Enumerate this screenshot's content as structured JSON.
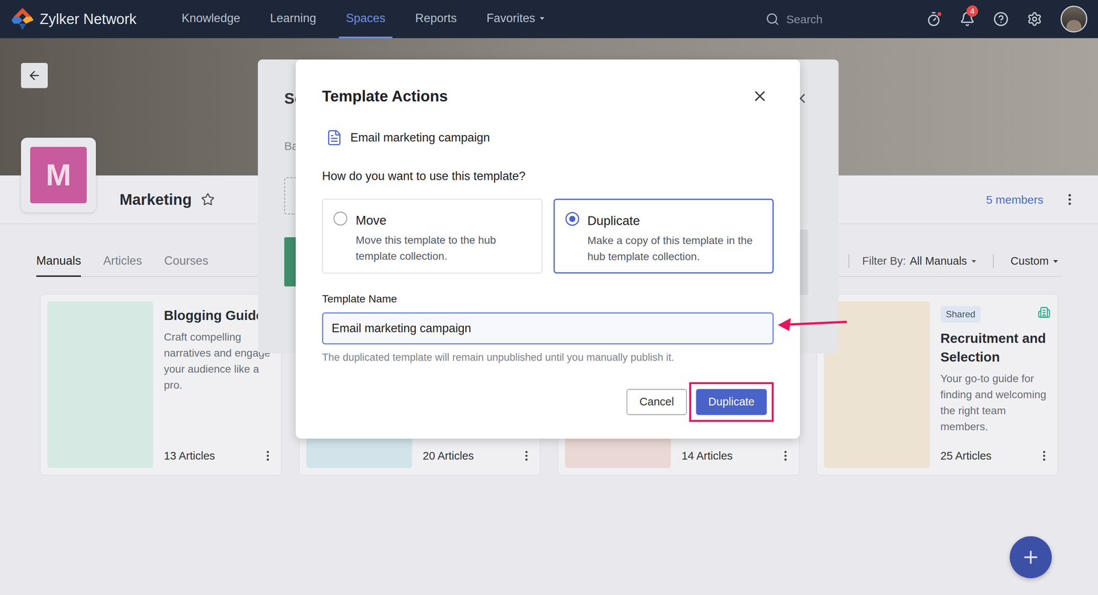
{
  "nav": {
    "brand": "Zylker Network",
    "items": [
      {
        "label": "Knowledge",
        "selected": false,
        "has_menu": false
      },
      {
        "label": "Learning",
        "selected": false,
        "has_menu": false
      },
      {
        "label": "Spaces",
        "selected": true,
        "has_menu": false
      },
      {
        "label": "Reports",
        "selected": false,
        "has_menu": false
      },
      {
        "label": "Favorites",
        "selected": false,
        "has_menu": true
      }
    ],
    "search": {
      "placeholder": "Search"
    },
    "notifications": {
      "count": "4"
    }
  },
  "space": {
    "initial": "M",
    "name": "Marketing",
    "favorite": false,
    "members": "5 members"
  },
  "tabs": [
    {
      "label": "Manuals",
      "selected": true
    },
    {
      "label": "Articles",
      "selected": false
    },
    {
      "label": "Courses",
      "selected": false
    }
  ],
  "filter": {
    "label": "Filter By:",
    "value": "All Manuals"
  },
  "sort": {
    "value": "Custom"
  },
  "cards": [
    {
      "title": "Blogging Guide",
      "description": "Craft compelling narratives and engage your audience like a pro.",
      "count": "13 Articles",
      "color": "#d7e9e3"
    },
    {
      "count": "20 Articles",
      "color": "#d2e4ea"
    },
    {
      "count": "14 Articles",
      "color": "#ead8d4"
    },
    {
      "title": "Recruitment and Selection",
      "description": "Your go-to guide for finding and welcoming the right team members.",
      "badge": "Shared",
      "count": "25 Articles",
      "color": "#ece3d3"
    }
  ],
  "background_dialog": {
    "title": "Se",
    "tab": "Ba"
  },
  "dialog": {
    "title": "Template Actions",
    "template_name": "Email marketing campaign",
    "question": "How do you want to use this template?",
    "options": [
      {
        "title": "Move",
        "description": "Move this template to the hub template collection.",
        "selected": false
      },
      {
        "title": "Duplicate",
        "description": "Make a copy of this template in the hub template collection.",
        "selected": true
      }
    ],
    "field": {
      "label": "Template Name",
      "value": "Email marketing campaign",
      "focused": true
    },
    "helper": "The duplicated template will remain unpublished until you manually publish it.",
    "buttons": [
      {
        "label": "Cancel",
        "kind": "secondary",
        "highlighted": false
      },
      {
        "label": "Duplicate",
        "kind": "primary",
        "highlighted": true
      }
    ]
  }
}
